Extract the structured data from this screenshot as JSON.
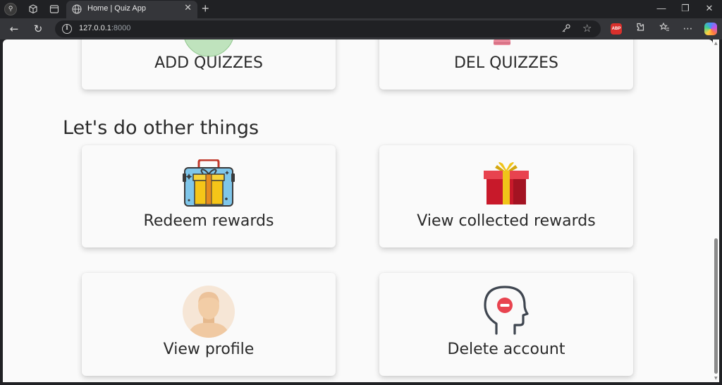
{
  "browser": {
    "tab_title": "Home | Quiz App",
    "url_host": "127.0.0.1",
    "url_port": ":8000",
    "new_tab_glyph": "+",
    "close_glyph": "✕",
    "abp_label": "ABP"
  },
  "window_controls": {
    "minimize": "—",
    "restore": "❐",
    "close": "✕"
  },
  "cards_top": [
    {
      "label": "ADD QUIZZES",
      "icon": "add-quiz-icon"
    },
    {
      "label": "DEL QUIZZES",
      "icon": "delete-quiz-icon"
    }
  ],
  "section": {
    "title": "Let's do other things"
  },
  "cards_other": [
    {
      "label": "Redeem rewards",
      "icon": "gift-bag-icon"
    },
    {
      "label": "View collected rewards",
      "icon": "gift-box-icon"
    },
    {
      "label": "View profile",
      "icon": "user-avatar-icon"
    },
    {
      "label": "Delete account",
      "icon": "remove-user-head-icon"
    }
  ],
  "colors": {
    "page_bg": "#fafafa",
    "text": "#2a2a2a",
    "chrome_dark": "#202124",
    "chrome_mid": "#35363a"
  }
}
